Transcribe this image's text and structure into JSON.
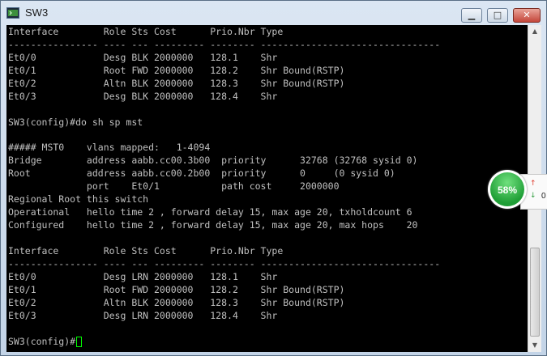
{
  "window": {
    "title": "SW3"
  },
  "titlebar_controls": {
    "minimize": "▁",
    "maximize": "□",
    "close": "✕"
  },
  "terminal": {
    "lines": [
      "Interface        Role Sts Cost      Prio.Nbr Type",
      "---------------- ---- --- --------- -------- --------------------------------",
      "Et0/0            Desg BLK 2000000   128.1    Shr",
      "Et0/1            Root FWD 2000000   128.2    Shr Bound(RSTP)",
      "Et0/2            Altn BLK 2000000   128.3    Shr Bound(RSTP)",
      "Et0/3            Desg BLK 2000000   128.4    Shr",
      "",
      "SW3(config)#do sh sp mst",
      "",
      "##### MST0    vlans mapped:   1-4094",
      "Bridge        address aabb.cc00.3b00  priority      32768 (32768 sysid 0)",
      "Root          address aabb.cc00.2b00  priority      0     (0 sysid 0)",
      "              port    Et0/1           path cost     2000000",
      "Regional Root this switch",
      "Operational   hello time 2 , forward delay 15, max age 20, txholdcount 6",
      "Configured    hello time 2 , forward delay 15, max age 20, max hops    20",
      "",
      "Interface        Role Sts Cost      Prio.Nbr Type",
      "---------------- ---- --- --------- -------- --------------------------------",
      "Et0/0            Desg LRN 2000000   128.1    Shr",
      "Et0/1            Root FWD 2000000   128.2    Shr Bound(RSTP)",
      "Et0/2            Altn BLK 2000000   128.3    Shr Bound(RSTP)",
      "Et0/3            Desg LRN 2000000   128.4    Shr",
      "",
      "SW3(config)#"
    ]
  },
  "widget": {
    "percent": "58%",
    "net_value": "0"
  },
  "colors": {
    "terminal_bg": "#000000",
    "terminal_fg": "#c0c0c0",
    "cursor": "#00ff00",
    "gauge": "#2fb84a"
  }
}
